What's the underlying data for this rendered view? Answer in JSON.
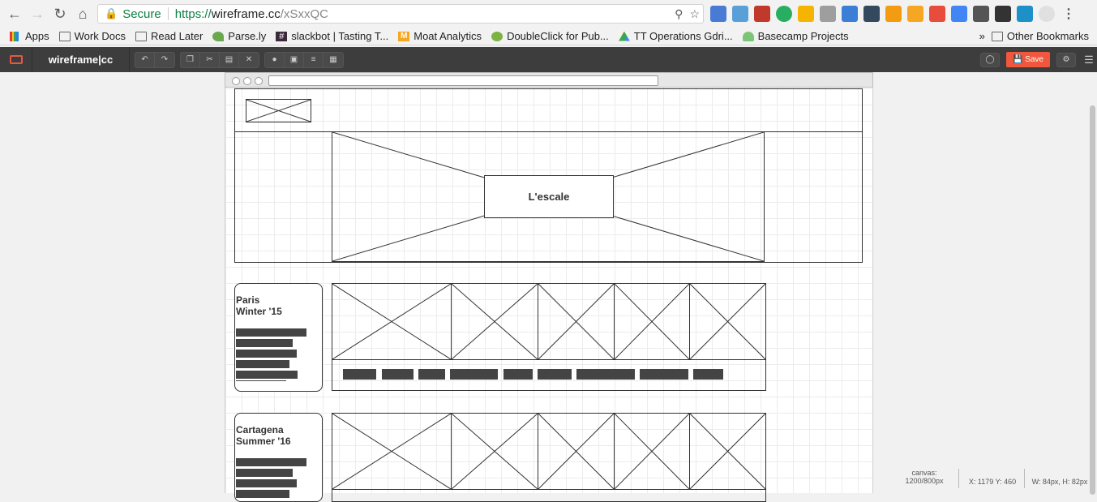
{
  "browser": {
    "secure_label": "Secure",
    "url_https": "https://",
    "url_host": "wireframe.cc",
    "url_path": "/xSxxQC"
  },
  "bookmarks": {
    "items": [
      {
        "label": "Apps",
        "icon": "apps-grid-icon"
      },
      {
        "label": "Work Docs",
        "icon": "folder-icon"
      },
      {
        "label": "Read Later",
        "icon": "folder-icon"
      },
      {
        "label": "Parse.ly",
        "icon": "parsely-icon"
      },
      {
        "label": "slackbot | Tasting T...",
        "icon": "slack-hash-icon"
      },
      {
        "label": "Moat Analytics",
        "icon": "moat-icon"
      },
      {
        "label": "DoubleClick for Pub...",
        "icon": "doubleclick-icon"
      },
      {
        "label": "TT Operations Gdri...",
        "icon": "google-drive-icon"
      },
      {
        "label": "Basecamp Projects",
        "icon": "basecamp-icon"
      }
    ],
    "overflow": "»",
    "other": "Other Bookmarks"
  },
  "toolbar": {
    "brand": "wireframe|cc",
    "save_label": "Save"
  },
  "wireframe": {
    "hero_title": "L'escale",
    "trips": [
      {
        "title": "Paris\nWinter '15"
      },
      {
        "title": "Cartagena\nSummer '16"
      }
    ]
  },
  "status": {
    "canvas_label": "canvas:",
    "canvas_value": "1200/800px",
    "coords": "X: 1179 Y: 460",
    "size": "W: 84px, H: 82px"
  }
}
